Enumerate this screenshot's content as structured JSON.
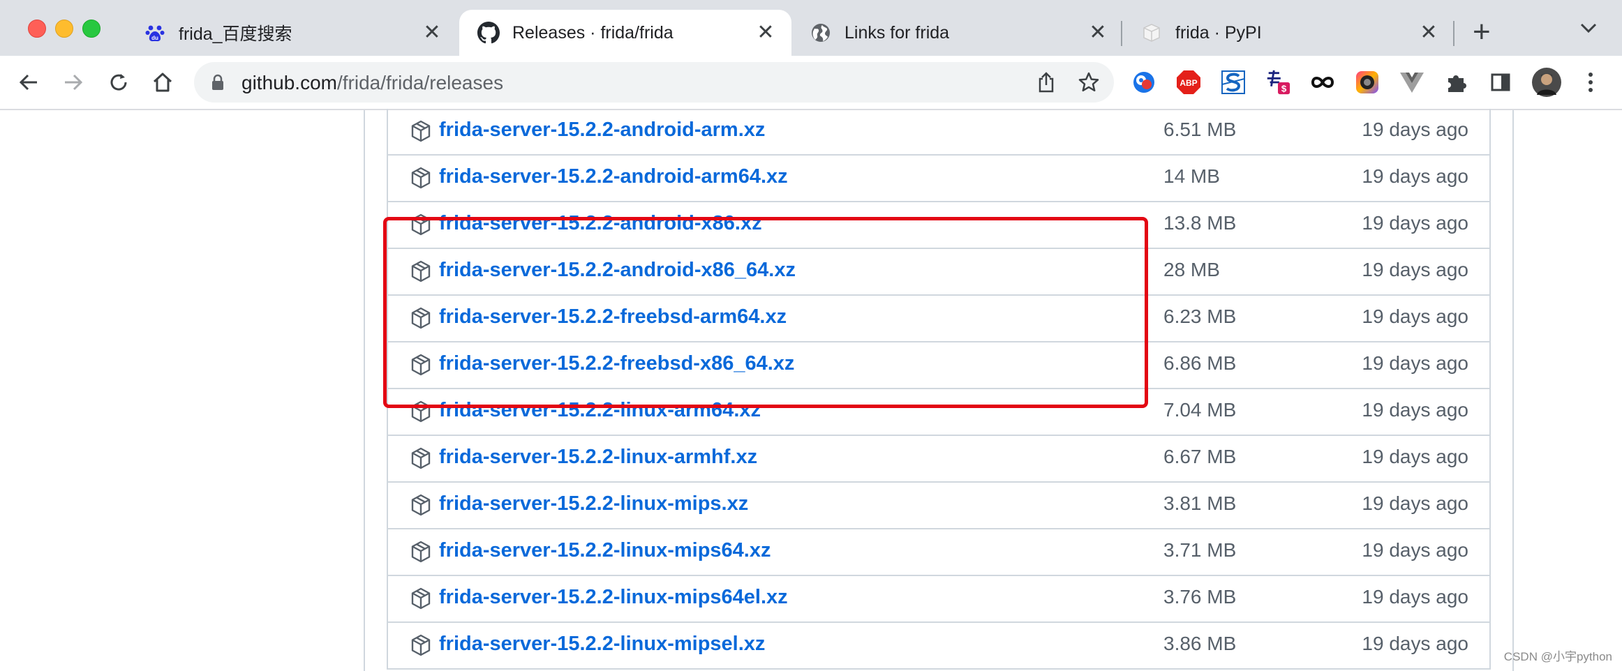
{
  "browser": {
    "tabs": [
      {
        "title": "frida_百度搜索",
        "icon": "baidu-paw-icon",
        "active": false
      },
      {
        "title": "Releases · frida/frida",
        "icon": "github-icon",
        "active": true
      },
      {
        "title": "Links for frida",
        "icon": "globe-icon",
        "active": false
      },
      {
        "title": "frida · PyPI",
        "icon": "pypi-cube-icon",
        "active": false
      }
    ],
    "close_glyph": "✕",
    "new_tab_glyph": "+",
    "address_bar": {
      "host": "github.com",
      "path": "/frida/frida/releases"
    },
    "extensions": [
      "extension-1-icon",
      "adblock-plus-icon",
      "s-extension-icon",
      "price-tag-extension-icon",
      "infinity-link-icon",
      "color-picker-icon",
      "vue-devtools-icon",
      "puzzle-extensions-icon",
      "side-panel-icon",
      "profile-avatar"
    ],
    "badges": {
      "abp": "ABP",
      "dollar": "$"
    }
  },
  "assets": [
    {
      "name": "frida-server-15.2.2-android-arm.xz",
      "size": "6.51 MB",
      "date": "19 days ago"
    },
    {
      "name": "frida-server-15.2.2-android-arm64.xz",
      "size": "14 MB",
      "date": "19 days ago"
    },
    {
      "name": "frida-server-15.2.2-android-x86.xz",
      "size": "13.8 MB",
      "date": "19 days ago"
    },
    {
      "name": "frida-server-15.2.2-android-x86_64.xz",
      "size": "28 MB",
      "date": "19 days ago"
    },
    {
      "name": "frida-server-15.2.2-freebsd-arm64.xz",
      "size": "6.23 MB",
      "date": "19 days ago"
    },
    {
      "name": "frida-server-15.2.2-freebsd-x86_64.xz",
      "size": "6.86 MB",
      "date": "19 days ago"
    },
    {
      "name": "frida-server-15.2.2-linux-arm64.xz",
      "size": "7.04 MB",
      "date": "19 days ago"
    },
    {
      "name": "frida-server-15.2.2-linux-armhf.xz",
      "size": "6.67 MB",
      "date": "19 days ago"
    },
    {
      "name": "frida-server-15.2.2-linux-mips.xz",
      "size": "3.81 MB",
      "date": "19 days ago"
    },
    {
      "name": "frida-server-15.2.2-linux-mips64.xz",
      "size": "3.71 MB",
      "date": "19 days ago"
    },
    {
      "name": "frida-server-15.2.2-linux-mips64el.xz",
      "size": "3.76 MB",
      "date": "19 days ago"
    },
    {
      "name": "frida-server-15.2.2-linux-mipsel.xz",
      "size": "3.86 MB",
      "date": "19 days ago"
    }
  ],
  "annotation": {
    "highlight_color": "#e30613",
    "highlighted_rows": [
      0,
      1,
      2,
      3
    ]
  },
  "colors": {
    "link": "#0969da",
    "muted": "#57606a",
    "border": "#d0d7de",
    "tabstrip": "#dee1e6"
  },
  "watermark": "CSDN @小宇python"
}
